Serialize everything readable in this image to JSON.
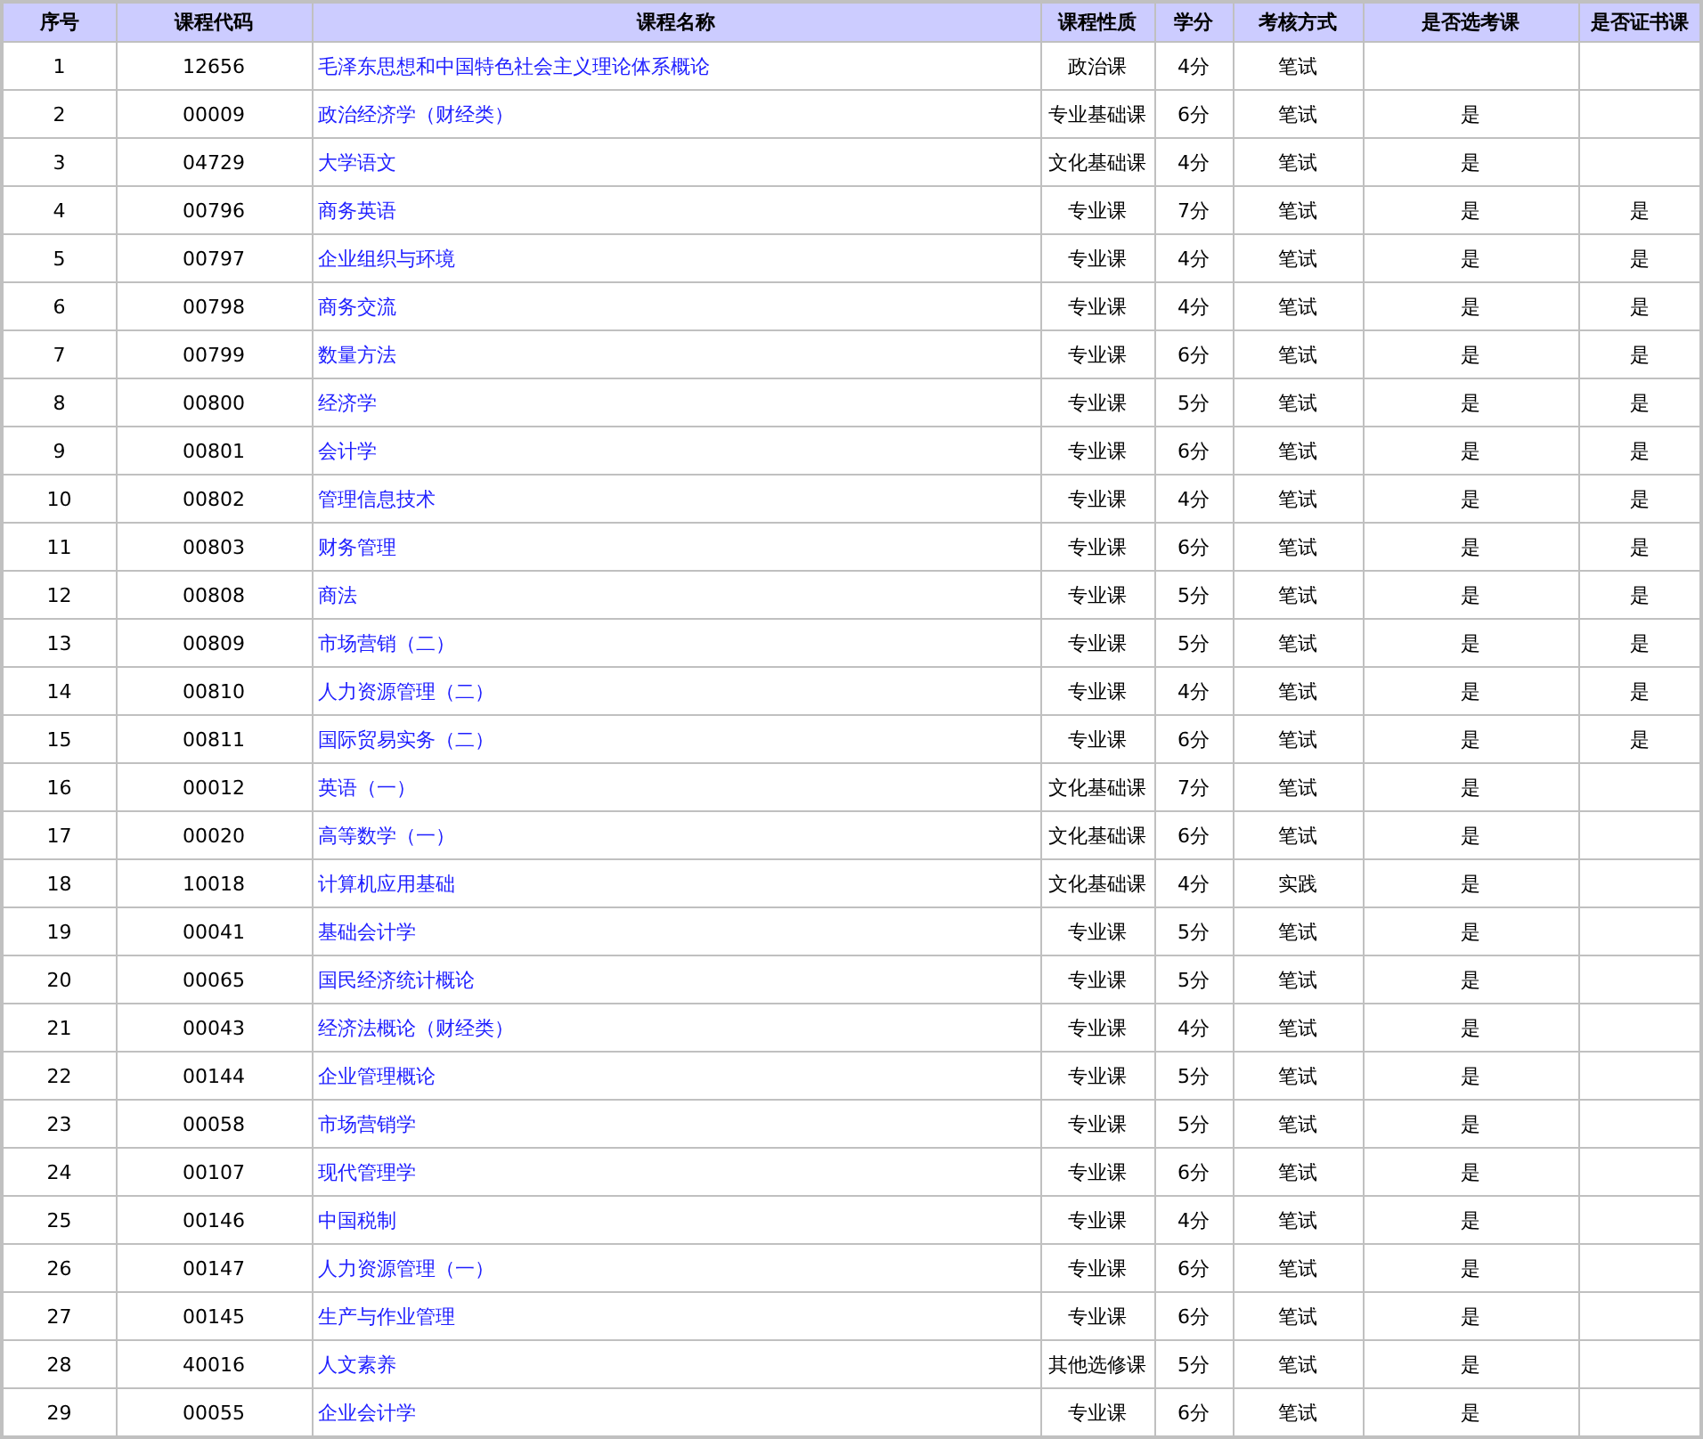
{
  "table": {
    "columns": [
      "序号",
      "课程代码",
      "课程名称",
      "课程性质",
      "学分",
      "考核方式",
      "是否选考课",
      "是否证书课"
    ],
    "rows": [
      {
        "no": "1",
        "code": "12656",
        "name": "毛泽东思想和中国特色社会主义理论体系概论",
        "type": "政治课",
        "credits": "4分",
        "exam": "笔试"
      },
      {
        "no": "2",
        "code": "00009",
        "name": "政治经济学（财经类）",
        "type": "专业基础课",
        "credits": "6分",
        "exam": "笔试",
        "elective": "是"
      },
      {
        "no": "3",
        "code": "04729",
        "name": "大学语文",
        "type": "文化基础课",
        "credits": "4分",
        "exam": "笔试",
        "elective": "是"
      },
      {
        "no": "4",
        "code": "00796",
        "name": "商务英语",
        "type": "专业课",
        "credits": "7分",
        "exam": "笔试",
        "elective": "是",
        "certificate": "是"
      },
      {
        "no": "5",
        "code": "00797",
        "name": "企业组织与环境",
        "type": "专业课",
        "credits": "4分",
        "exam": "笔试",
        "elective": "是",
        "certificate": "是"
      },
      {
        "no": "6",
        "code": "00798",
        "name": "商务交流",
        "type": "专业课",
        "credits": "4分",
        "exam": "笔试",
        "elective": "是",
        "certificate": "是"
      },
      {
        "no": "7",
        "code": "00799",
        "name": "数量方法",
        "type": "专业课",
        "credits": "6分",
        "exam": "笔试",
        "elective": "是",
        "certificate": "是"
      },
      {
        "no": "8",
        "code": "00800",
        "name": "经济学",
        "type": "专业课",
        "credits": "5分",
        "exam": "笔试",
        "elective": "是",
        "certificate": "是"
      },
      {
        "no": "9",
        "code": "00801",
        "name": "会计学",
        "type": "专业课",
        "credits": "6分",
        "exam": "笔试",
        "elective": "是",
        "certificate": "是"
      },
      {
        "no": "10",
        "code": "00802",
        "name": "管理信息技术",
        "type": "专业课",
        "credits": "4分",
        "exam": "笔试",
        "elective": "是",
        "certificate": "是"
      },
      {
        "no": "11",
        "code": "00803",
        "name": "财务管理",
        "type": "专业课",
        "credits": "6分",
        "exam": "笔试",
        "elective": "是",
        "certificate": "是"
      },
      {
        "no": "12",
        "code": "00808",
        "name": "商法",
        "type": "专业课",
        "credits": "5分",
        "exam": "笔试",
        "elective": "是",
        "certificate": "是"
      },
      {
        "no": "13",
        "code": "00809",
        "name": "市场营销（二）",
        "type": "专业课",
        "credits": "5分",
        "exam": "笔试",
        "elective": "是",
        "certificate": "是"
      },
      {
        "no": "14",
        "code": "00810",
        "name": "人力资源管理（二）",
        "type": "专业课",
        "credits": "4分",
        "exam": "笔试",
        "elective": "是",
        "certificate": "是"
      },
      {
        "no": "15",
        "code": "00811",
        "name": "国际贸易实务（二）",
        "type": "专业课",
        "credits": "6分",
        "exam": "笔试",
        "elective": "是",
        "certificate": "是"
      },
      {
        "no": "16",
        "code": "00012",
        "name": "英语（一）",
        "type": "文化基础课",
        "credits": "7分",
        "exam": "笔试",
        "elective": "是"
      },
      {
        "no": "17",
        "code": "00020",
        "name": "高等数学（一）",
        "type": "文化基础课",
        "credits": "6分",
        "exam": "笔试",
        "elective": "是"
      },
      {
        "no": "18",
        "code": "10018",
        "name": "计算机应用基础",
        "type": "文化基础课",
        "credits": "4分",
        "exam": "实践",
        "elective": "是"
      },
      {
        "no": "19",
        "code": "00041",
        "name": "基础会计学",
        "type": "专业课",
        "credits": "5分",
        "exam": "笔试",
        "elective": "是"
      },
      {
        "no": "20",
        "code": "00065",
        "name": "国民经济统计概论",
        "type": "专业课",
        "credits": "5分",
        "exam": "笔试",
        "elective": "是"
      },
      {
        "no": "21",
        "code": "00043",
        "name": "经济法概论（财经类）",
        "type": "专业课",
        "credits": "4分",
        "exam": "笔试",
        "elective": "是"
      },
      {
        "no": "22",
        "code": "00144",
        "name": "企业管理概论",
        "type": "专业课",
        "credits": "5分",
        "exam": "笔试",
        "elective": "是"
      },
      {
        "no": "23",
        "code": "00058",
        "name": "市场营销学",
        "type": "专业课",
        "credits": "5分",
        "exam": "笔试",
        "elective": "是"
      },
      {
        "no": "24",
        "code": "00107",
        "name": "现代管理学",
        "type": "专业课",
        "credits": "6分",
        "exam": "笔试",
        "elective": "是"
      },
      {
        "no": "25",
        "code": "00146",
        "name": "中国税制",
        "type": "专业课",
        "credits": "4分",
        "exam": "笔试",
        "elective": "是"
      },
      {
        "no": "26",
        "code": "00147",
        "name": "人力资源管理（一）",
        "type": "专业课",
        "credits": "6分",
        "exam": "笔试",
        "elective": "是"
      },
      {
        "no": "27",
        "code": "00145",
        "name": "生产与作业管理",
        "type": "专业课",
        "credits": "6分",
        "exam": "笔试",
        "elective": "是"
      },
      {
        "no": "28",
        "code": "40016",
        "name": "人文素养",
        "type": "其他选修课",
        "credits": "5分",
        "exam": "笔试",
        "elective": "是"
      },
      {
        "no": "29",
        "code": "00055",
        "name": "企业会计学",
        "type": "专业课",
        "credits": "6分",
        "exam": "笔试",
        "elective": "是"
      }
    ]
  }
}
